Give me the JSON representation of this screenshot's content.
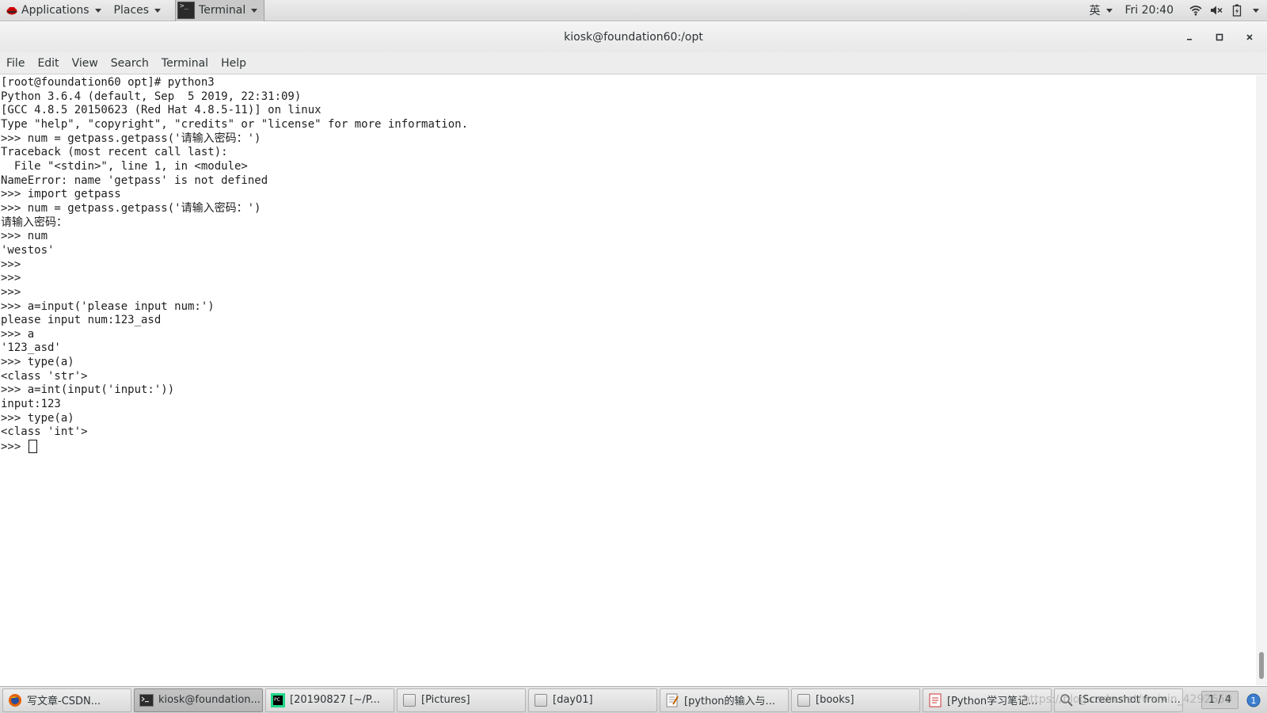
{
  "topbar": {
    "applications": "Applications",
    "places": "Places",
    "terminal": "Terminal",
    "input_method": "英",
    "clock": "Fri 20:40"
  },
  "window": {
    "title": "kiosk@foundation60:/opt"
  },
  "menubar": [
    "File",
    "Edit",
    "View",
    "Search",
    "Terminal",
    "Help"
  ],
  "terminal": {
    "lines": [
      "[root@foundation60 opt]# python3",
      "Python 3.6.4 (default, Sep  5 2019, 22:31:09)",
      "[GCC 4.8.5 20150623 (Red Hat 4.8.5-11)] on linux",
      "Type \"help\", \"copyright\", \"credits\" or \"license\" for more information.",
      ">>> num = getpass.getpass('请输入密码：')",
      "Traceback (most recent call last):",
      "  File \"<stdin>\", line 1, in <module>",
      "NameError: name 'getpass' is not defined",
      ">>> import getpass",
      ">>> num = getpass.getpass('请输入密码：')",
      "请输入密码：",
      ">>> num",
      "'westos'",
      ">>>",
      ">>>",
      ">>>",
      ">>> a=input('please input num:')",
      "please input num:123_asd",
      ">>> a",
      "'123_asd'",
      ">>> type(a)",
      "<class 'str'>",
      ">>> a=int(input('input:'))",
      "input:123",
      ">>> type(a)",
      "<class 'int'>"
    ],
    "prompt": ">>> "
  },
  "taskbar": {
    "tasks": [
      {
        "label": "写文章-CSDN...",
        "icon": "firefox-icon",
        "active": false
      },
      {
        "label": "kiosk@foundation...",
        "icon": "terminal-icon",
        "active": true
      },
      {
        "label": "[20190827 [~/P...",
        "icon": "pycharm-icon",
        "active": false
      },
      {
        "label": "[Pictures]",
        "icon": "folder-icon",
        "active": false
      },
      {
        "label": "[day01]",
        "icon": "folder-icon",
        "active": false
      },
      {
        "label": "[python的输入与...",
        "icon": "text-editor-icon",
        "active": false
      },
      {
        "label": "[books]",
        "icon": "folder-icon",
        "active": false
      },
      {
        "label": "[Python学习笔记...",
        "icon": "document-icon",
        "active": false
      },
      {
        "label": "[Screenshot from ...",
        "icon": "screenshot-icon",
        "active": false
      }
    ],
    "workspace": "1 / 4",
    "watermark": "https://blog.csdn.net/weixin_4292659"
  }
}
